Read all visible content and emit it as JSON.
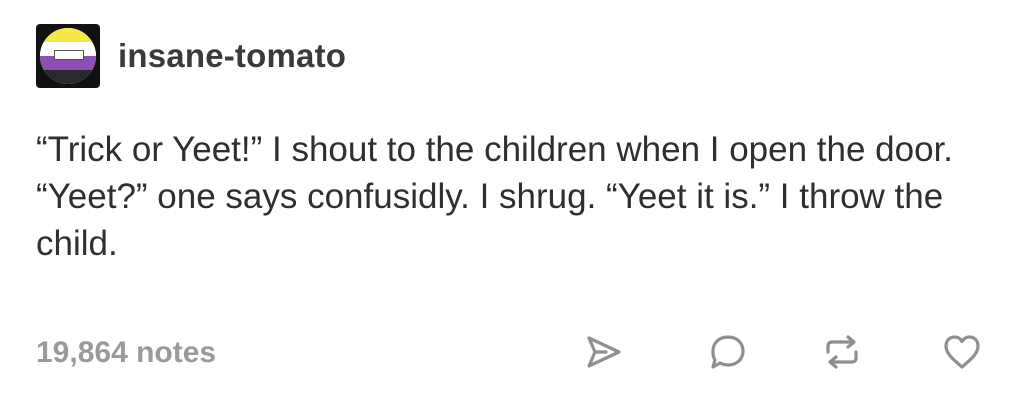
{
  "post": {
    "username": "insane-tomato",
    "text": "“Trick or Yeet!” I shout to the children when I open the door. “Yeet?” one says confusidly. I shrug. “Yeet it is.” I throw the child.",
    "notes": "19,864 notes"
  },
  "avatar": {
    "colors": [
      "#f7e84a",
      "#ffffff",
      "#8e4fb4",
      "#2a2a2a"
    ]
  },
  "actions": [
    {
      "icon": "share-icon"
    },
    {
      "icon": "reply-icon"
    },
    {
      "icon": "reblog-icon"
    },
    {
      "icon": "heart-icon"
    }
  ]
}
